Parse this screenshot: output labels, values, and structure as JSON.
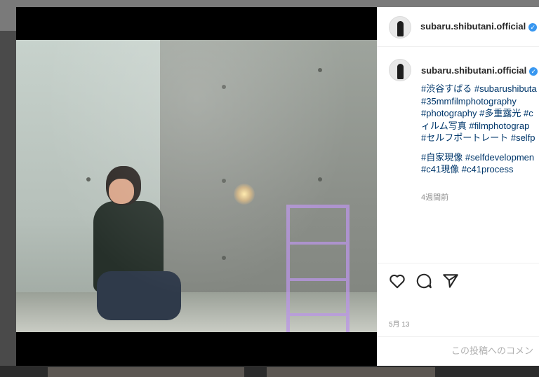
{
  "post": {
    "username": "subaru.shibutani.official",
    "verified_glyph": "✓",
    "caption_lines": [
      "#渋谷すばる #subarushibuta",
      "#35mmfilmphotography",
      "#photography #多重露光 #c",
      "ィルム写真 #filmphotograp",
      "#セルフポートレート #selfp",
      "",
      "#自家現像 #selfdevelopmen",
      "#c41現像 #c41process"
    ],
    "time_ago": "4週間前",
    "date": "5月 13",
    "comment_placeholder": "この投稿へのコメン"
  },
  "icons": {
    "like": "heart-icon",
    "comment": "comment-icon",
    "share": "send-icon",
    "verified": "verified-badge-icon"
  },
  "colors": {
    "hashtag": "#00376b",
    "verified": "#3897f0",
    "muted": "#8e8e8e",
    "backdrop": "#4a4a4a"
  }
}
